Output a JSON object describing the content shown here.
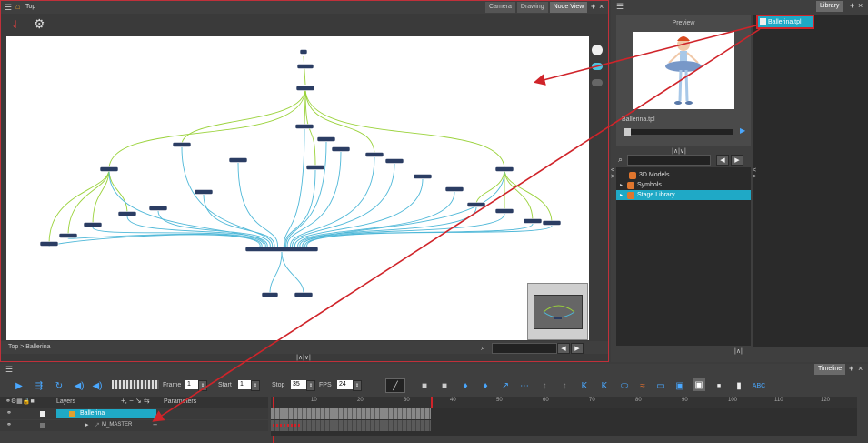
{
  "node_view": {
    "breadcrumb_top": "Top",
    "tabs": [
      "Camera",
      "Drawing",
      "Node View"
    ],
    "footer_path": "Top > Ballerina"
  },
  "preview": {
    "title": "Preview",
    "filename": "Ballerina.tpl"
  },
  "library": {
    "title": "Library",
    "selected_file": "Ballerina.tpl",
    "tree": [
      "3D Models",
      "Symbols",
      "Stage Library"
    ]
  },
  "timeline": {
    "title": "Timeline",
    "frame_label": "Frame",
    "frame_value": "1",
    "start_label": "Start",
    "start_value": "1",
    "stop_label": "Stop",
    "stop_value": "35",
    "fps_label": "FPS",
    "fps_value": "24",
    "layers_header": "Layers",
    "params_header": "Parameters",
    "layers": [
      "Ballerina",
      "M_MASTER"
    ],
    "ruler": [
      "10",
      "20",
      "30",
      "40",
      "50",
      "60",
      "70",
      "80",
      "90",
      "100",
      "110",
      "120"
    ]
  },
  "colors": {
    "selection_red": "#d0242a",
    "highlight_teal": "#1fa9c6",
    "cable_green": "#9ad23a",
    "cable_blue": "#4fb8d8"
  }
}
